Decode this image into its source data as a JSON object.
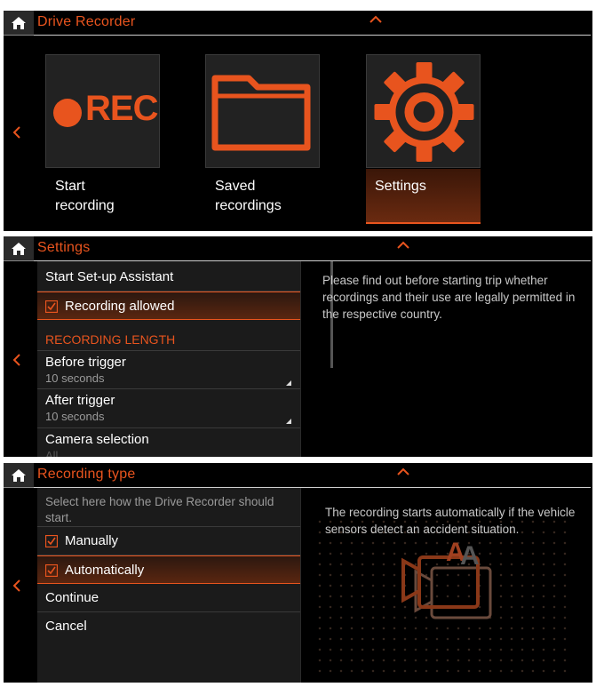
{
  "colors": {
    "accent": "#e8541e",
    "background": "#000000",
    "list_bg": "#1b1b1b",
    "text": "#ffffff",
    "muted": "#9a9a9a"
  },
  "screen1": {
    "title": "Drive Recorder",
    "tiles": [
      {
        "icon": "rec-icon",
        "rec_text": "REC",
        "line1": "Start",
        "line2": "recording"
      },
      {
        "icon": "folder-icon",
        "line1": "Saved",
        "line2": "recordings"
      },
      {
        "icon": "gear-icon",
        "line1": "Settings",
        "line2": ""
      }
    ],
    "selected_tile": "Settings"
  },
  "screen2": {
    "title": "Settings",
    "items": {
      "setup": "Start Set-up Assistant",
      "recording_allowed": "Recording allowed",
      "section_header": "RECORDING LENGTH",
      "before_trigger": {
        "label": "Before trigger",
        "value": "10 seconds"
      },
      "after_trigger": {
        "label": "After trigger",
        "value": "10 seconds"
      },
      "camera_selection": {
        "label": "Camera selection",
        "value": "All"
      }
    },
    "info": "Please find out before starting trip whether recordings and their use are legally permitted in the respective country."
  },
  "screen3": {
    "title": "Recording type",
    "hint": "Select here how the Drive Recorder should start.",
    "items": {
      "manually": "Manually",
      "automatically": "Automatically",
      "continue": "Continue",
      "cancel": "Cancel"
    },
    "info": "The recording starts automatically if the vehicle sensors detect an accident situation.",
    "illustration_letter": "A"
  }
}
